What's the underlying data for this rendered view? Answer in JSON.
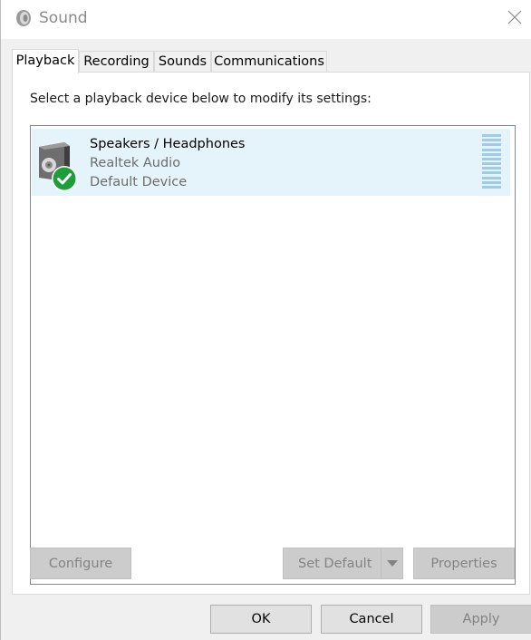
{
  "window": {
    "title": "Sound",
    "icon": "speaker-icon",
    "close_icon": "close-icon"
  },
  "tabs": [
    {
      "label": "Playback",
      "active": true
    },
    {
      "label": "Recording",
      "active": false
    },
    {
      "label": "Sounds",
      "active": false
    },
    {
      "label": "Communications",
      "active": false
    }
  ],
  "playback": {
    "instruction": "Select a playback device below to modify its settings:",
    "devices": [
      {
        "name": "Speakers / Headphones",
        "driver": "Realtek Audio",
        "status": "Default Device",
        "icon": "speaker-device-icon",
        "status_icon": "green-check-icon",
        "selected": true
      }
    ],
    "buttons": {
      "configure": "Configure",
      "set_default": "Set Default",
      "properties": "Properties"
    }
  },
  "footer": {
    "ok": "OK",
    "cancel": "Cancel",
    "apply": "Apply"
  },
  "colors": {
    "selection": "#e5f3fb",
    "check": "#1e9e3a",
    "level_meter": "#9fcbe6"
  }
}
